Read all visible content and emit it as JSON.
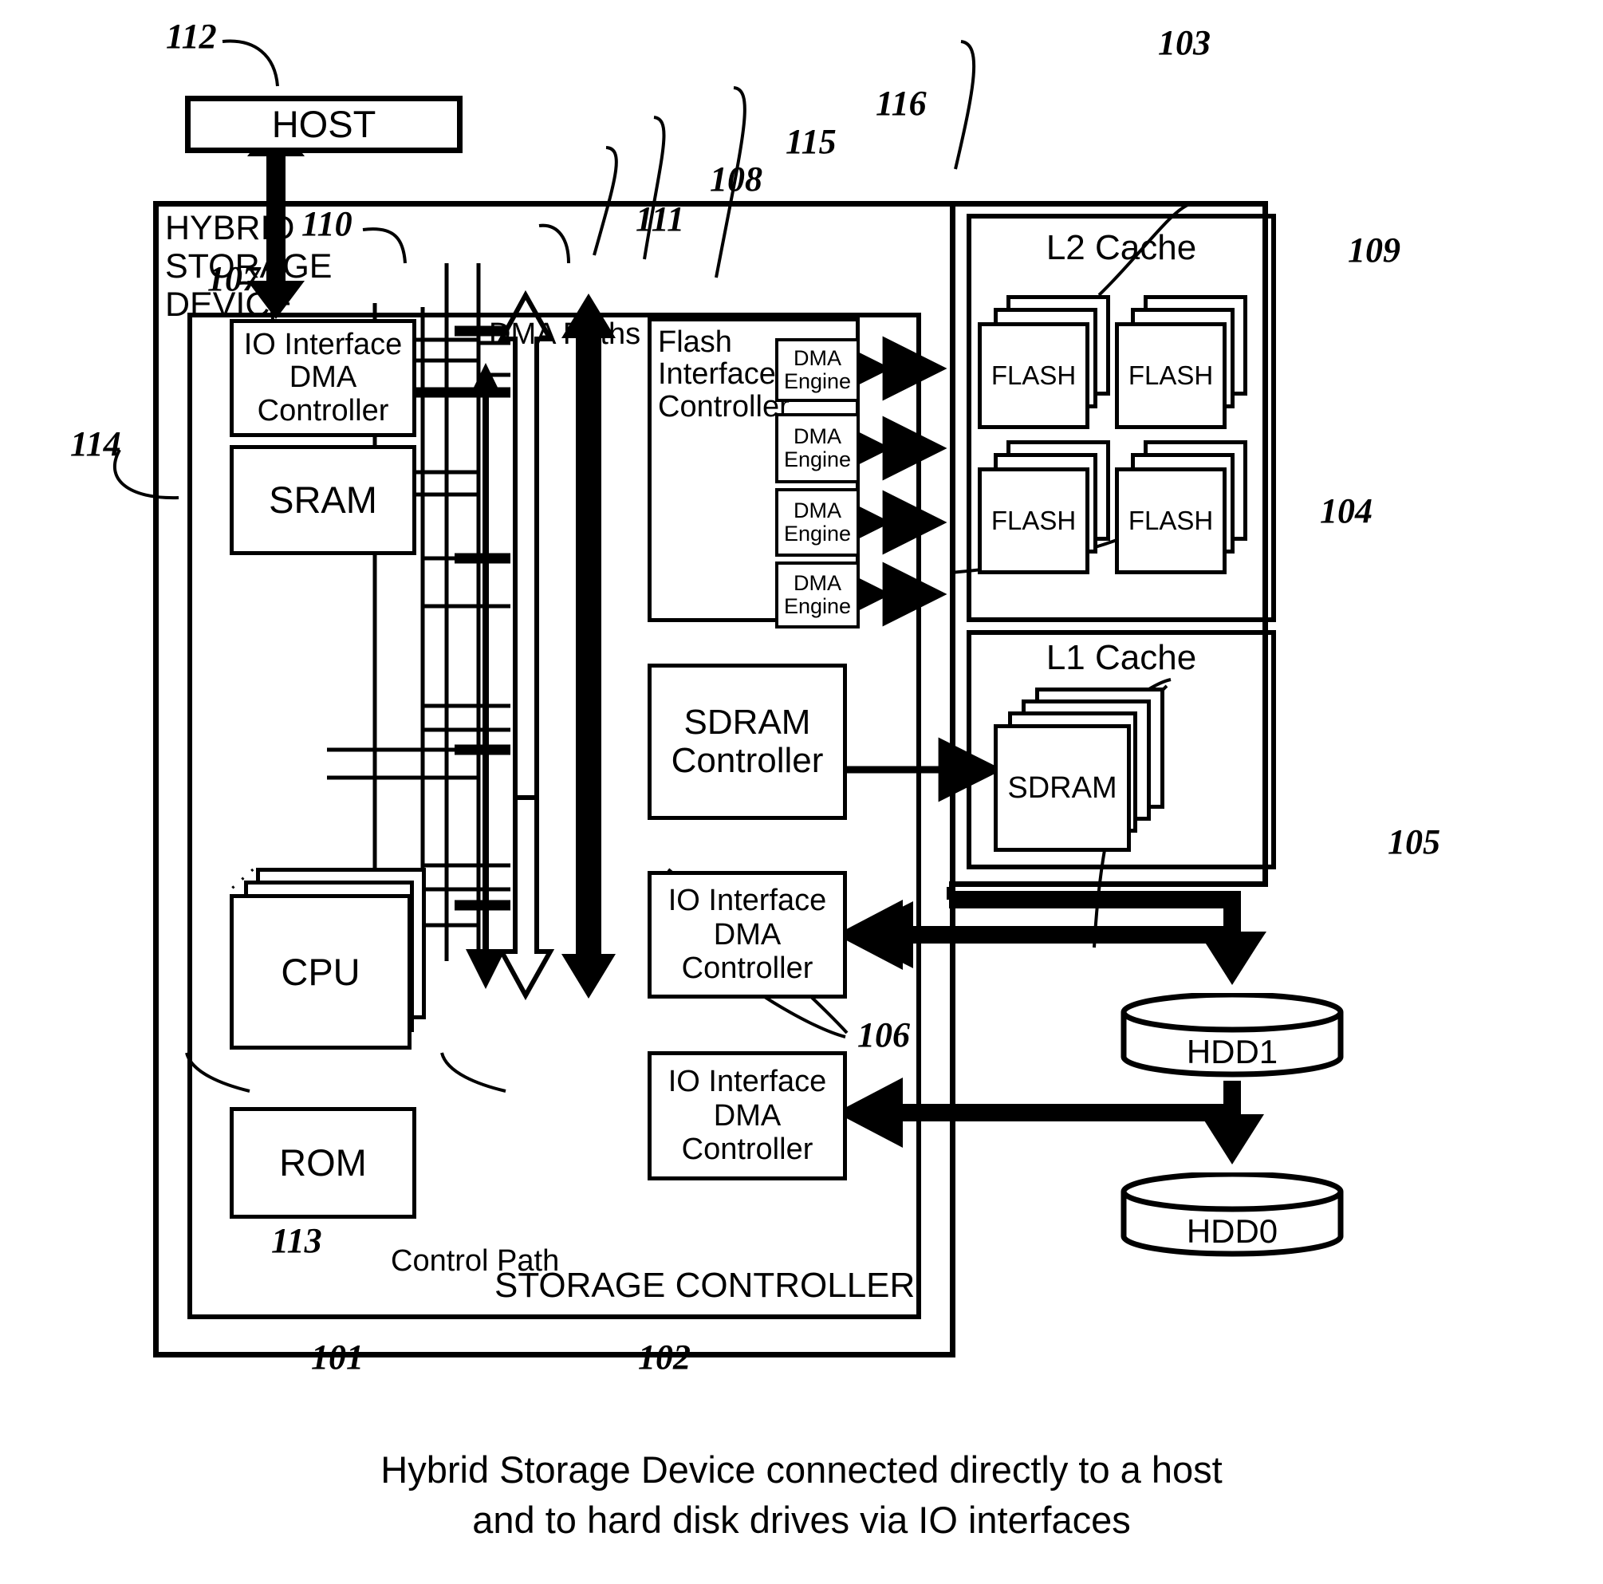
{
  "figure": {
    "caption_line1": "Hybrid Storage Device connected directly to a host",
    "caption_line2": "and to hard disk drives via IO interfaces"
  },
  "blocks": {
    "host": "HOST",
    "hybrid_storage_device": "HYBRID\nSTORAGE\nDEVICE",
    "storage_controller": "STORAGE CONTROLLER",
    "io_interface_dma_controller_top": "IO Interface\nDMA\nController",
    "io_interface_dma_controller_mid": "IO Interface\nDMA\nController",
    "io_interface_dma_controller_bot": "IO Interface\nDMA\nController",
    "sram": "SRAM",
    "cpu": "CPU",
    "rom": "ROM",
    "flash_interface_controller": "Flash\nInterface\nController",
    "sdram_controller": "SDRAM\nController",
    "l2_cache": "L2 Cache",
    "l1_cache": "L1 Cache",
    "sdram_cache": "SDRAM",
    "hdd1": "HDD1",
    "hdd0": "HDD0",
    "flash_1": "FLASH",
    "flash_2": "FLASH",
    "flash_3": "FLASH",
    "flash_4": "FLASH",
    "dma_engine_1": "DMA\nEngine",
    "dma_engine_2": "DMA\nEngine",
    "dma_engine_3": "DMA\nEngine",
    "dma_engine_4": "DMA\nEngine"
  },
  "path_labels": {
    "dma_paths": "DMA Paths",
    "control_path": "Control Path"
  },
  "reference_numerals": {
    "n101": "101",
    "n102": "102",
    "n103": "103",
    "n104": "104",
    "n105": "105",
    "n106": "106",
    "n107": "107",
    "n108": "108",
    "n109": "109",
    "n110": "110",
    "n111": "111",
    "n112": "112",
    "n113": "113",
    "n114": "114",
    "n115": "115",
    "n116": "116"
  },
  "colors": {
    "ink": "#000000",
    "paper": "#ffffff"
  }
}
